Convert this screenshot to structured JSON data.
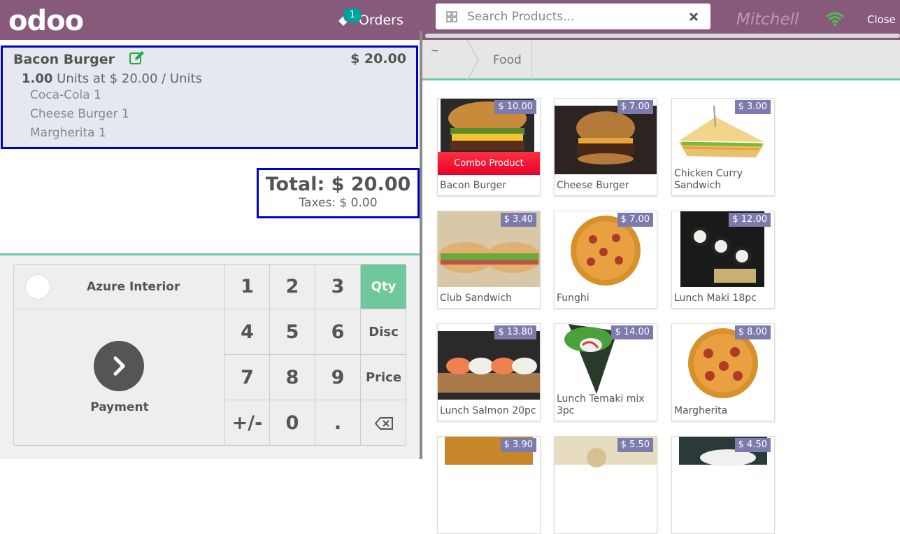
{
  "header": {
    "logo": "odoo",
    "orders_count": "1",
    "orders_label": "Orders",
    "search_placeholder": "Search Products...",
    "cashier": "Mitchell Admin",
    "close_label": "Close"
  },
  "order": {
    "line": {
      "name": "Bacon Burger",
      "price": "$ 20.00",
      "qty": "1.00",
      "qty_detail": "Units at $ 20.00 / Units",
      "combo_items": [
        "Coca-Cola 1",
        "Cheese Burger 1",
        "Margherita 1"
      ]
    },
    "total": "Total: $ 20.00",
    "taxes": "Taxes: $ 0.00"
  },
  "pad": {
    "customer": "Azure Interior",
    "payment_label": "Payment",
    "keys": [
      "1",
      "2",
      "3",
      "Qty",
      "4",
      "5",
      "6",
      "Disc",
      "7",
      "8",
      "9",
      "Price",
      "+/-",
      "0",
      ".",
      "⌫"
    ]
  },
  "categories": {
    "home": "~",
    "current": "Food"
  },
  "products": [
    {
      "name": "Bacon Burger",
      "price": "$ 10.00",
      "combo": "Combo Product",
      "image": "burger-bacon"
    },
    {
      "name": "Cheese Burger",
      "price": "$ 7.00",
      "image": "burger-cheese"
    },
    {
      "name": "Chicken Curry Sandwich",
      "price": "$ 3.00",
      "image": "sandwich-chicken"
    },
    {
      "name": "Club Sandwich",
      "price": "$ 3.40",
      "image": "sandwich-club"
    },
    {
      "name": "Funghi",
      "price": "$ 7.00",
      "image": "pizza-funghi"
    },
    {
      "name": "Lunch Maki 18pc",
      "price": "$ 12.00",
      "image": "maki"
    },
    {
      "name": "Lunch Salmon 20pc",
      "price": "$ 13.80",
      "image": "salmon-sushi"
    },
    {
      "name": "Lunch Temaki mix 3pc",
      "price": "$ 14.00",
      "image": "temaki"
    },
    {
      "name": "Margherita",
      "price": "$ 8.00",
      "image": "pizza-margherita"
    },
    {
      "name": "",
      "price": "$ 3.90",
      "image": "food"
    },
    {
      "name": "",
      "price": "$ 5.50",
      "image": "pasta"
    },
    {
      "name": "",
      "price": "$ 4.50",
      "image": "salad"
    }
  ],
  "colors": {
    "brand": "#875A7B",
    "accent": "#6EC89B",
    "price_tag": "#7C7BAD",
    "selection": "#0000CC"
  }
}
